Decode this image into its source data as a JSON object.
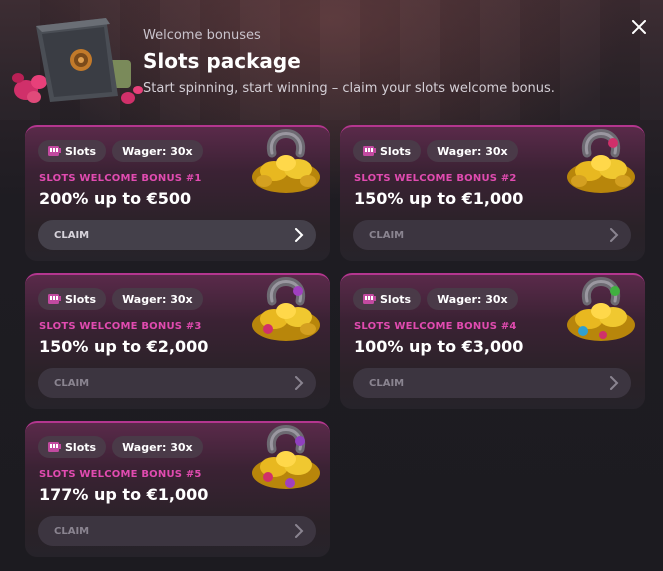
{
  "header": {
    "subtitle": "Welcome bonuses",
    "title": "Slots package",
    "description": "Start spinning, start winning – claim your slots welcome bonus."
  },
  "close": {
    "label": "✕"
  },
  "cards": [
    {
      "tag_type": "Slots",
      "tag_wager": "Wager: 30x",
      "label": "SLOTS WELCOME BONUS #1",
      "amount": "200% up to €500",
      "claim": "CLAIM",
      "active": true
    },
    {
      "tag_type": "Slots",
      "tag_wager": "Wager: 30x",
      "label": "SLOTS WELCOME BONUS #2",
      "amount": "150% up to €1,000",
      "claim": "CLAIM",
      "active": false
    },
    {
      "tag_type": "Slots",
      "tag_wager": "Wager: 30x",
      "label": "SLOTS WELCOME BONUS #3",
      "amount": "150% up to €2,000",
      "claim": "CLAIM",
      "active": false
    },
    {
      "tag_type": "Slots",
      "tag_wager": "Wager: 30x",
      "label": "SLOTS WELCOME BONUS #4",
      "amount": "100% up to €3,000",
      "claim": "CLAIM",
      "active": false
    },
    {
      "tag_type": "Slots",
      "tag_wager": "Wager: 30x",
      "label": "SLOTS WELCOME BONUS #5",
      "amount": "177% up to €1,000",
      "claim": "CLAIM",
      "active": false
    }
  ],
  "colors": {
    "accent_pink": "#e14bb0",
    "card_border": "#b4368f",
    "button_bg": "#3c3540"
  },
  "icons": {
    "close": "close-icon",
    "tag": "slot-machine-icon",
    "claim": "chevron-right-icon",
    "art": "horseshoe-gold-icon",
    "header_art": "safe-with-gems-icon"
  }
}
